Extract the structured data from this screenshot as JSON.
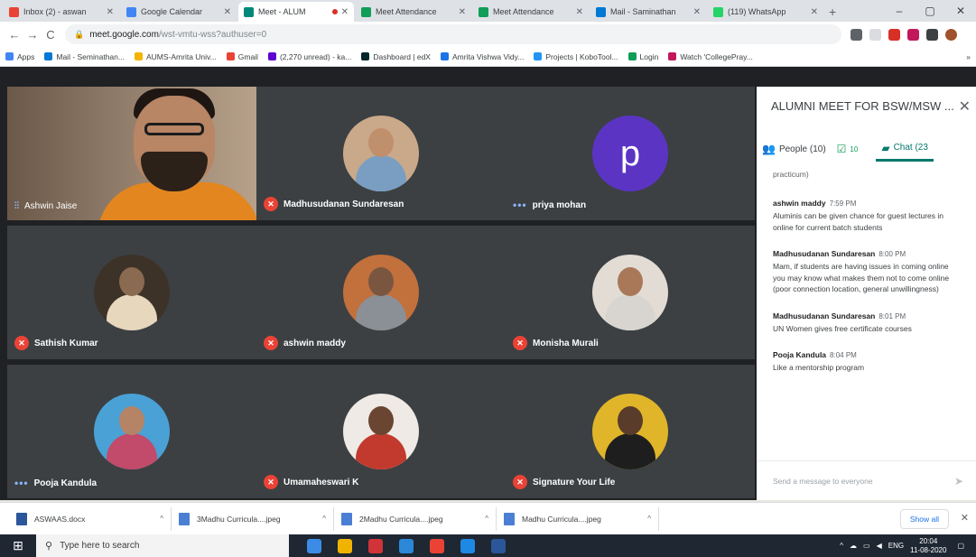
{
  "browser": {
    "tabs": [
      {
        "title": "Inbox (2) - aswan",
        "color": "#ea4335"
      },
      {
        "title": "Google Calendar",
        "color": "#4285f4"
      },
      {
        "title": "Meet - ALUM",
        "color": "#00897b",
        "active": true
      },
      {
        "title": "Meet Attendance",
        "color": "#0f9d58"
      },
      {
        "title": "Meet Attendance",
        "color": "#0f9d58"
      },
      {
        "title": "Mail - Saminathan",
        "color": "#0078d4"
      },
      {
        "title": "(119) WhatsApp",
        "color": "#25d366"
      }
    ],
    "new_tab": "+",
    "win_min": "–",
    "win_max": "▢",
    "win_close": "✕",
    "back": "←",
    "forward": "→",
    "reload": "C",
    "url_host": "meet.google.com",
    "url_path": "/wst-vmtu-wss?authuser=0",
    "bookmarks": [
      {
        "label": "Apps",
        "color": "#4285f4"
      },
      {
        "label": "Mail - Seminathan...",
        "color": "#0078d4"
      },
      {
        "label": "AUMS-Amrita Univ...",
        "color": "#f4b400"
      },
      {
        "label": "Gmail",
        "color": "#ea4335"
      },
      {
        "label": "(2,270 unread) - ka...",
        "color": "#6001d2"
      },
      {
        "label": "Dashboard | edX",
        "color": "#02262b"
      },
      {
        "label": "Amrita Vishwa Vidy...",
        "color": "#1a73e8"
      },
      {
        "label": "Projects | KoboTool...",
        "color": "#2095f3"
      },
      {
        "label": "Login",
        "color": "#0f9d58"
      },
      {
        "label": "Watch 'CollegePray...",
        "color": "#c2185b"
      }
    ],
    "bookmarks_more": "»"
  },
  "meet": {
    "participants": [
      {
        "name": "Ashwin Jaise",
        "status": "speaking",
        "type": "video"
      },
      {
        "name": "Madhusudanan Sundaresan",
        "status": "muted",
        "type": "photo",
        "head": "#c08f6c",
        "body": "#7a9ec2",
        "bg": "#c9a98a"
      },
      {
        "name": "priya mohan",
        "status": "dots",
        "type": "letter",
        "letter": "p"
      },
      {
        "name": "Sathish Kumar",
        "status": "muted",
        "type": "photo",
        "head": "#8a6a50",
        "body": "#e6d7bd",
        "bg": "#3d3228"
      },
      {
        "name": "ashwin maddy",
        "status": "muted",
        "type": "photo",
        "head": "#7a5640",
        "body": "#8b8f96",
        "bg": "#c2703c"
      },
      {
        "name": "Monisha Murali",
        "status": "muted",
        "type": "photo",
        "head": "#a87858",
        "body": "#d8d4cf",
        "bg": "#e2dcd4"
      },
      {
        "name": "Pooja Kandula",
        "status": "dots",
        "type": "photo",
        "head": "#b58466",
        "body": "#c24a6a",
        "bg": "#4aa1d6"
      },
      {
        "name": "Umamaheswari K",
        "status": "muted",
        "type": "photo",
        "head": "#6a4632",
        "body": "#c23a2e",
        "bg": "#efeae5"
      },
      {
        "name": "Signature Your Life",
        "status": "muted",
        "type": "photo",
        "head": "#5a3c2a",
        "body": "#1e1e1e",
        "bg": "#e0b52a"
      }
    ],
    "panel_title": "ALUMNI MEET FOR BSW/MSW ...",
    "panel_close": "✕",
    "people_tab": "People (10)",
    "tasks_tab": "10",
    "chat_tab": "Chat (23",
    "prev_fragment": "practicum)",
    "messages": [
      {
        "sender": "ashwin maddy",
        "time": "7:59 PM",
        "text": "Aluminis can be given chance for guest lectures in online for current batch students"
      },
      {
        "sender": "Madhusudanan Sundaresan",
        "time": "8:00 PM",
        "text": "Mam, if students are having issues in coming online you may know what makes them not to come online (poor connection location, general unwillingness)"
      },
      {
        "sender": "Madhusudanan Sundaresan",
        "time": "8:01 PM",
        "text": "UN Women gives free certificate courses"
      },
      {
        "sender": "Pooja Kandula",
        "time": "8:04 PM",
        "text": "Like a mentorship program"
      }
    ],
    "composer_placeholder": "Send a message to everyone",
    "send_icon": "➤"
  },
  "downloads": {
    "items": [
      {
        "name": "ASWAAS.docx",
        "color": "#2b579a"
      },
      {
        "name": "3Madhu Curricula....jpeg",
        "color": "#4a7fd4"
      },
      {
        "name": "2Madhu Curricula....jpeg",
        "color": "#4a7fd4"
      },
      {
        "name": "Madhu Curricula....jpeg",
        "color": "#4a7fd4"
      }
    ],
    "caret": "^",
    "show_all": "Show all",
    "close": "✕"
  },
  "taskbar": {
    "search_placeholder": "Type here to search",
    "apps": [
      "#3c8ce7",
      "#f0b400",
      "#d13438",
      "#2b88d8",
      "#ea4335",
      "#1e88e5",
      "#2b579a"
    ],
    "lang": "ENG",
    "time": "20:04",
    "date": "11-08-2020"
  }
}
